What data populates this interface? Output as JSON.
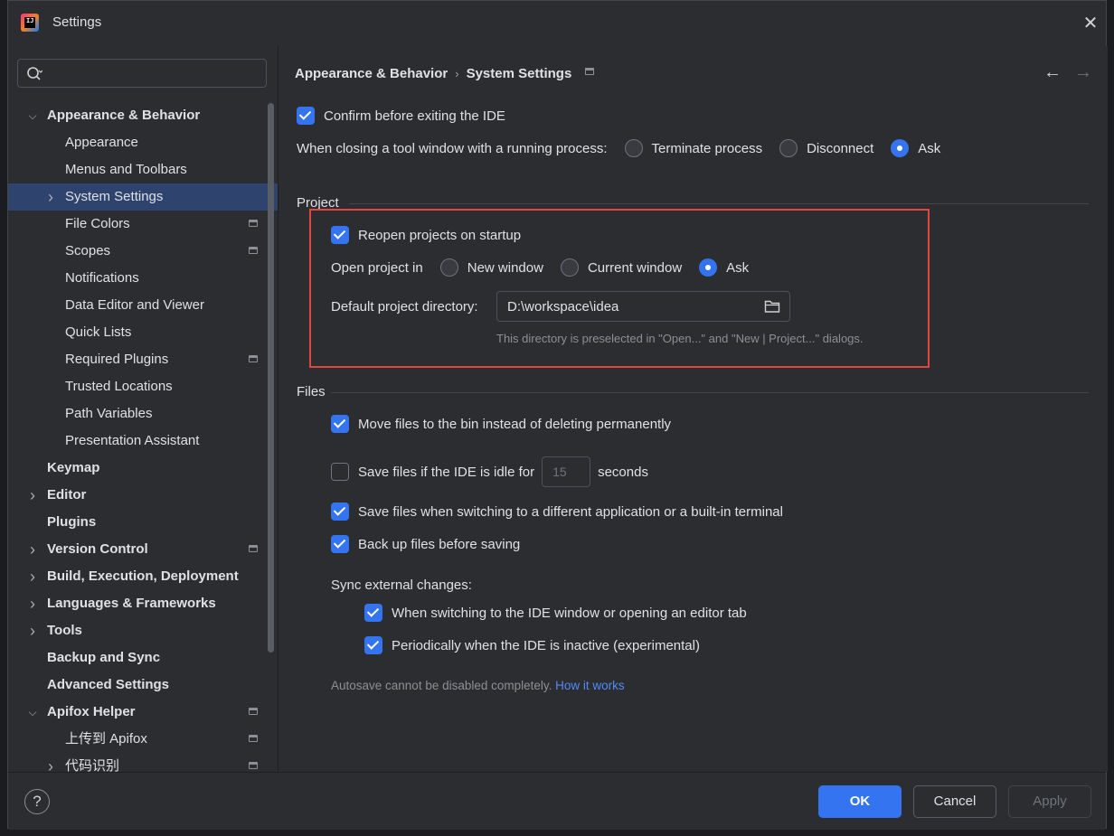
{
  "window": {
    "title": "Settings",
    "app_icon": "intellij-idea-icon"
  },
  "search": {
    "placeholder": ""
  },
  "sidebar": {
    "items": [
      {
        "label": "Appearance & Behavior",
        "level": 0,
        "bold": true,
        "chevron": "down",
        "proj": false,
        "selected": false
      },
      {
        "label": "Appearance",
        "level": 1,
        "bold": false,
        "chevron": "",
        "proj": false,
        "selected": false
      },
      {
        "label": "Menus and Toolbars",
        "level": 1,
        "bold": false,
        "chevron": "",
        "proj": false,
        "selected": false
      },
      {
        "label": "System Settings",
        "level": 1,
        "bold": false,
        "chevron": "right",
        "proj": false,
        "selected": true
      },
      {
        "label": "File Colors",
        "level": 1,
        "bold": false,
        "chevron": "",
        "proj": true,
        "selected": false
      },
      {
        "label": "Scopes",
        "level": 1,
        "bold": false,
        "chevron": "",
        "proj": true,
        "selected": false
      },
      {
        "label": "Notifications",
        "level": 1,
        "bold": false,
        "chevron": "",
        "proj": false,
        "selected": false
      },
      {
        "label": "Data Editor and Viewer",
        "level": 1,
        "bold": false,
        "chevron": "",
        "proj": false,
        "selected": false
      },
      {
        "label": "Quick Lists",
        "level": 1,
        "bold": false,
        "chevron": "",
        "proj": false,
        "selected": false
      },
      {
        "label": "Required Plugins",
        "level": 1,
        "bold": false,
        "chevron": "",
        "proj": true,
        "selected": false
      },
      {
        "label": "Trusted Locations",
        "level": 1,
        "bold": false,
        "chevron": "",
        "proj": false,
        "selected": false
      },
      {
        "label": "Path Variables",
        "level": 1,
        "bold": false,
        "chevron": "",
        "proj": false,
        "selected": false
      },
      {
        "label": "Presentation Assistant",
        "level": 1,
        "bold": false,
        "chevron": "",
        "proj": false,
        "selected": false
      },
      {
        "label": "Keymap",
        "level": 0,
        "bold": true,
        "chevron": "",
        "proj": false,
        "selected": false
      },
      {
        "label": "Editor",
        "level": 0,
        "bold": true,
        "chevron": "right",
        "proj": false,
        "selected": false
      },
      {
        "label": "Plugins",
        "level": 0,
        "bold": true,
        "chevron": "",
        "proj": false,
        "selected": false
      },
      {
        "label": "Version Control",
        "level": 0,
        "bold": true,
        "chevron": "right",
        "proj": true,
        "selected": false
      },
      {
        "label": "Build, Execution, Deployment",
        "level": 0,
        "bold": true,
        "chevron": "right",
        "proj": false,
        "selected": false
      },
      {
        "label": "Languages & Frameworks",
        "level": 0,
        "bold": true,
        "chevron": "right",
        "proj": false,
        "selected": false
      },
      {
        "label": "Tools",
        "level": 0,
        "bold": true,
        "chevron": "right",
        "proj": false,
        "selected": false
      },
      {
        "label": "Backup and Sync",
        "level": 0,
        "bold": true,
        "chevron": "",
        "proj": false,
        "selected": false
      },
      {
        "label": "Advanced Settings",
        "level": 0,
        "bold": true,
        "chevron": "",
        "proj": false,
        "selected": false
      },
      {
        "label": "Apifox Helper",
        "level": 0,
        "bold": true,
        "chevron": "down",
        "proj": true,
        "selected": false
      },
      {
        "label": "上传到 Apifox",
        "level": 1,
        "bold": false,
        "chevron": "",
        "proj": true,
        "selected": false
      },
      {
        "label": "代码识别",
        "level": 1,
        "bold": false,
        "chevron": "right",
        "proj": true,
        "selected": false
      }
    ]
  },
  "breadcrumb": {
    "parent": "Appearance & Behavior",
    "sep": "›",
    "current": "System Settings"
  },
  "general": {
    "confirm_exit": {
      "label": "Confirm before exiting the IDE",
      "checked": true
    },
    "closing_tool_window": {
      "label": "When closing a tool window with a running process:",
      "options": [
        "Terminate process",
        "Disconnect",
        "Ask"
      ],
      "selected": "Ask"
    }
  },
  "project": {
    "title": "Project",
    "reopen": {
      "label": "Reopen projects on startup",
      "checked": true
    },
    "open_in": {
      "label": "Open project in",
      "options": [
        "New window",
        "Current window",
        "Ask"
      ],
      "selected": "Ask"
    },
    "default_dir": {
      "label": "Default project directory:",
      "value": "D:\\workspace\\idea",
      "hint": "This directory is preselected in \"Open...\" and \"New | Project...\" dialogs."
    }
  },
  "files": {
    "title": "Files",
    "move_to_bin": {
      "label": "Move files to the bin instead of deleting permanently",
      "checked": true
    },
    "save_idle": {
      "label_before": "Save files if the IDE is idle for",
      "value": "15",
      "label_after": "seconds",
      "checked": false
    },
    "save_switching": {
      "label": "Save files when switching to a different application or a built-in terminal",
      "checked": true
    },
    "backup": {
      "label": "Back up files before saving",
      "checked": true
    },
    "sync_label": "Sync external changes:",
    "sync_switching": {
      "label": "When switching to the IDE window or opening an editor tab",
      "checked": true
    },
    "sync_periodic": {
      "label": "Periodically when the IDE is inactive (experimental)",
      "checked": true
    },
    "autosave_note": "Autosave cannot be disabled completely.",
    "autosave_link": "How it works"
  },
  "buttons": {
    "help": "?",
    "ok": "OK",
    "cancel": "Cancel",
    "apply": "Apply"
  },
  "colors": {
    "accent": "#3574f0",
    "highlight_box": "#e0463c",
    "selection": "#2e436e",
    "link": "#548af7"
  }
}
